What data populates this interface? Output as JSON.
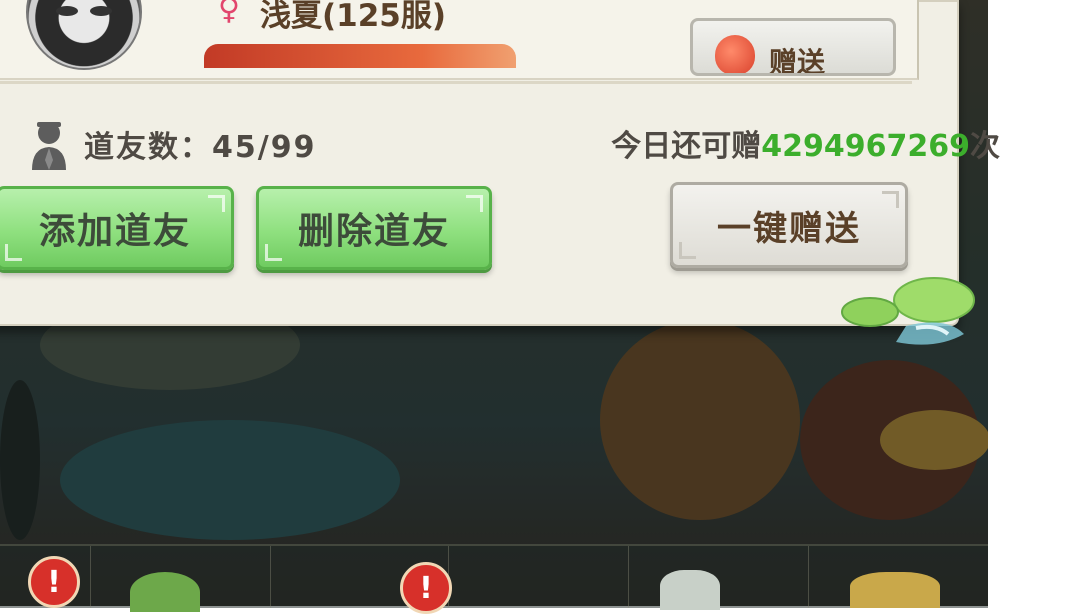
{
  "profile": {
    "gender_symbol": "♀",
    "player_name": "浅夏(125服)"
  },
  "gift_top_button": {
    "label": "赠送"
  },
  "friends": {
    "label": "道友数：",
    "count": "45/99"
  },
  "gift_remaining": {
    "prefix": "今日还可赠",
    "count": "4294967269",
    "suffix": "次"
  },
  "buttons": {
    "add_friend": "添加道友",
    "delete_friend": "删除道友",
    "gift_all": "一键赠送"
  },
  "alerts": {
    "mark": "!"
  },
  "colors": {
    "gift_count": "#3cae2c",
    "green_button": "#8fe07f",
    "gender": "#e2456d",
    "alert": "#d7302a"
  },
  "icons": {
    "friend": "person-silhouette-icon",
    "gift": "peach-icon",
    "decoration": "lotus-leaf-icon"
  }
}
